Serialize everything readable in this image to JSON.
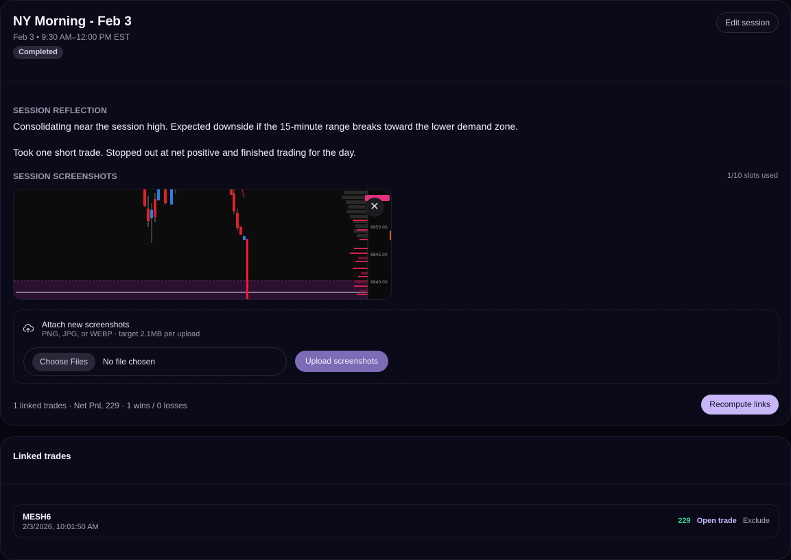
{
  "session": {
    "title": "NY Morning - Feb 3",
    "subtitle": "Feb 3 • 9:30 AM–12:00 PM EST",
    "status": "Completed",
    "edit_label": "Edit session"
  },
  "reflection": {
    "label": "SESSION REFLECTION",
    "paragraph1": "Consolidating near the session high. Expected downside if the 15-minute range breaks toward the lower demand zone.",
    "paragraph2": "Took one short trade. Stopped out at net positive and finished trading for the day."
  },
  "screenshots": {
    "label": "SESSION SCREENSHOTS",
    "slots": "1/10 slots used",
    "remove_glyph": "✕",
    "price_labels": [
      "6850.00",
      "6845.00",
      "6840.00"
    ]
  },
  "attach": {
    "title": "Attach new screenshots",
    "hint": "PNG, JPG, or WEBP · target 2.1MB per upload",
    "choose_label": "Choose Files",
    "no_file_label": "No file chosen",
    "upload_label": "Upload screenshots",
    "icon": "upload-cloud-icon"
  },
  "summary": {
    "text": "1 linked trades · Net PnL 229 · 1 wins / 0 losses",
    "recompute_label": "Recompute links"
  },
  "linked": {
    "title": "Linked trades",
    "trades": [
      {
        "symbol": "MESH6",
        "time": "2/3/2026, 10:01:50 AM",
        "pnl": "229",
        "open_label": "Open trade",
        "exclude_label": "Exclude"
      }
    ]
  },
  "colors": {
    "accent": "#c7b6f8",
    "profit": "#35d399",
    "background": "#07060f"
  }
}
